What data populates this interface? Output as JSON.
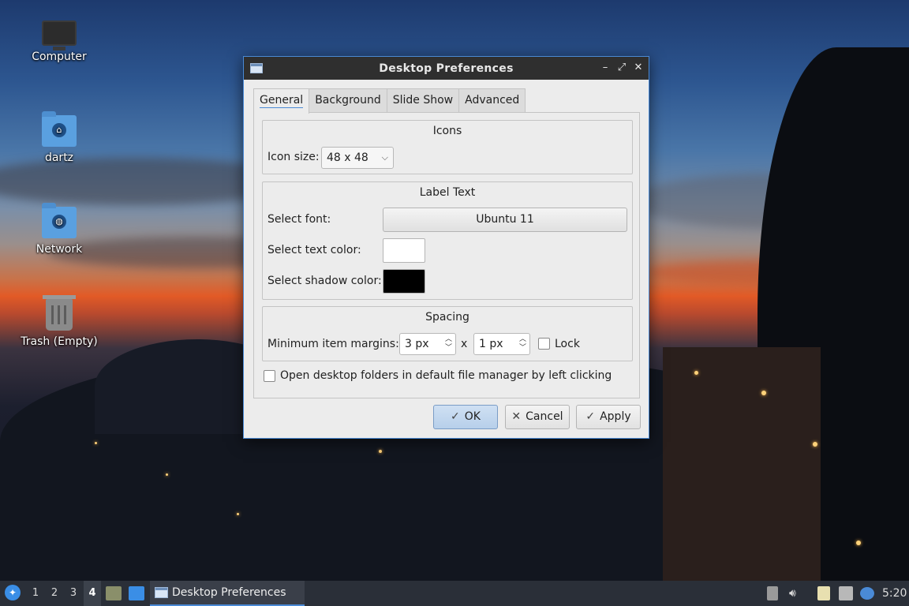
{
  "desktop": {
    "icons": [
      {
        "label": "Computer",
        "icon": "computer-icon"
      },
      {
        "label": "dartz",
        "icon": "home-folder-icon"
      },
      {
        "label": "Network",
        "icon": "network-folder-icon"
      },
      {
        "label": "Trash (Empty)",
        "icon": "trash-icon"
      }
    ]
  },
  "dialog": {
    "title": "Desktop Preferences",
    "controls": {
      "minimize": "–",
      "maximize": "⤢",
      "close": "✕"
    },
    "tabs": [
      {
        "label": "General",
        "active": true
      },
      {
        "label": "Background",
        "active": false
      },
      {
        "label": "Slide Show",
        "active": false
      },
      {
        "label": "Advanced",
        "active": false
      }
    ],
    "icons_group": {
      "title": "Icons",
      "icon_size_label": "Icon size:",
      "icon_size_value": "48 x 48"
    },
    "label_text_group": {
      "title": "Label Text",
      "font_label": "Select font:",
      "font_value": "Ubuntu 11",
      "text_color_label": "Select text color:",
      "text_color": "#ffffff",
      "shadow_color_label": "Select shadow color:",
      "shadow_color": "#000000"
    },
    "spacing_group": {
      "title": "Spacing",
      "margins_label": "Minimum item margins:",
      "margin_x": "3 px",
      "separator": "x",
      "margin_y": "1 px",
      "lock_label": "Lock",
      "lock_checked": false
    },
    "open_folders_label": "Open desktop folders in default file manager by left clicking",
    "open_folders_checked": false,
    "buttons": {
      "ok": "OK",
      "cancel": "Cancel",
      "apply": "Apply"
    }
  },
  "taskbar": {
    "workspaces": [
      "1",
      "2",
      "3",
      "4"
    ],
    "active_workspace": "4",
    "task_title": "Desktop Preferences",
    "clock": "5:20"
  },
  "colors": {
    "accent": "#4a8ad6",
    "titlebar": "#2f2f2f",
    "taskbar": "#2a2f38",
    "dialog_bg": "#ececec"
  }
}
